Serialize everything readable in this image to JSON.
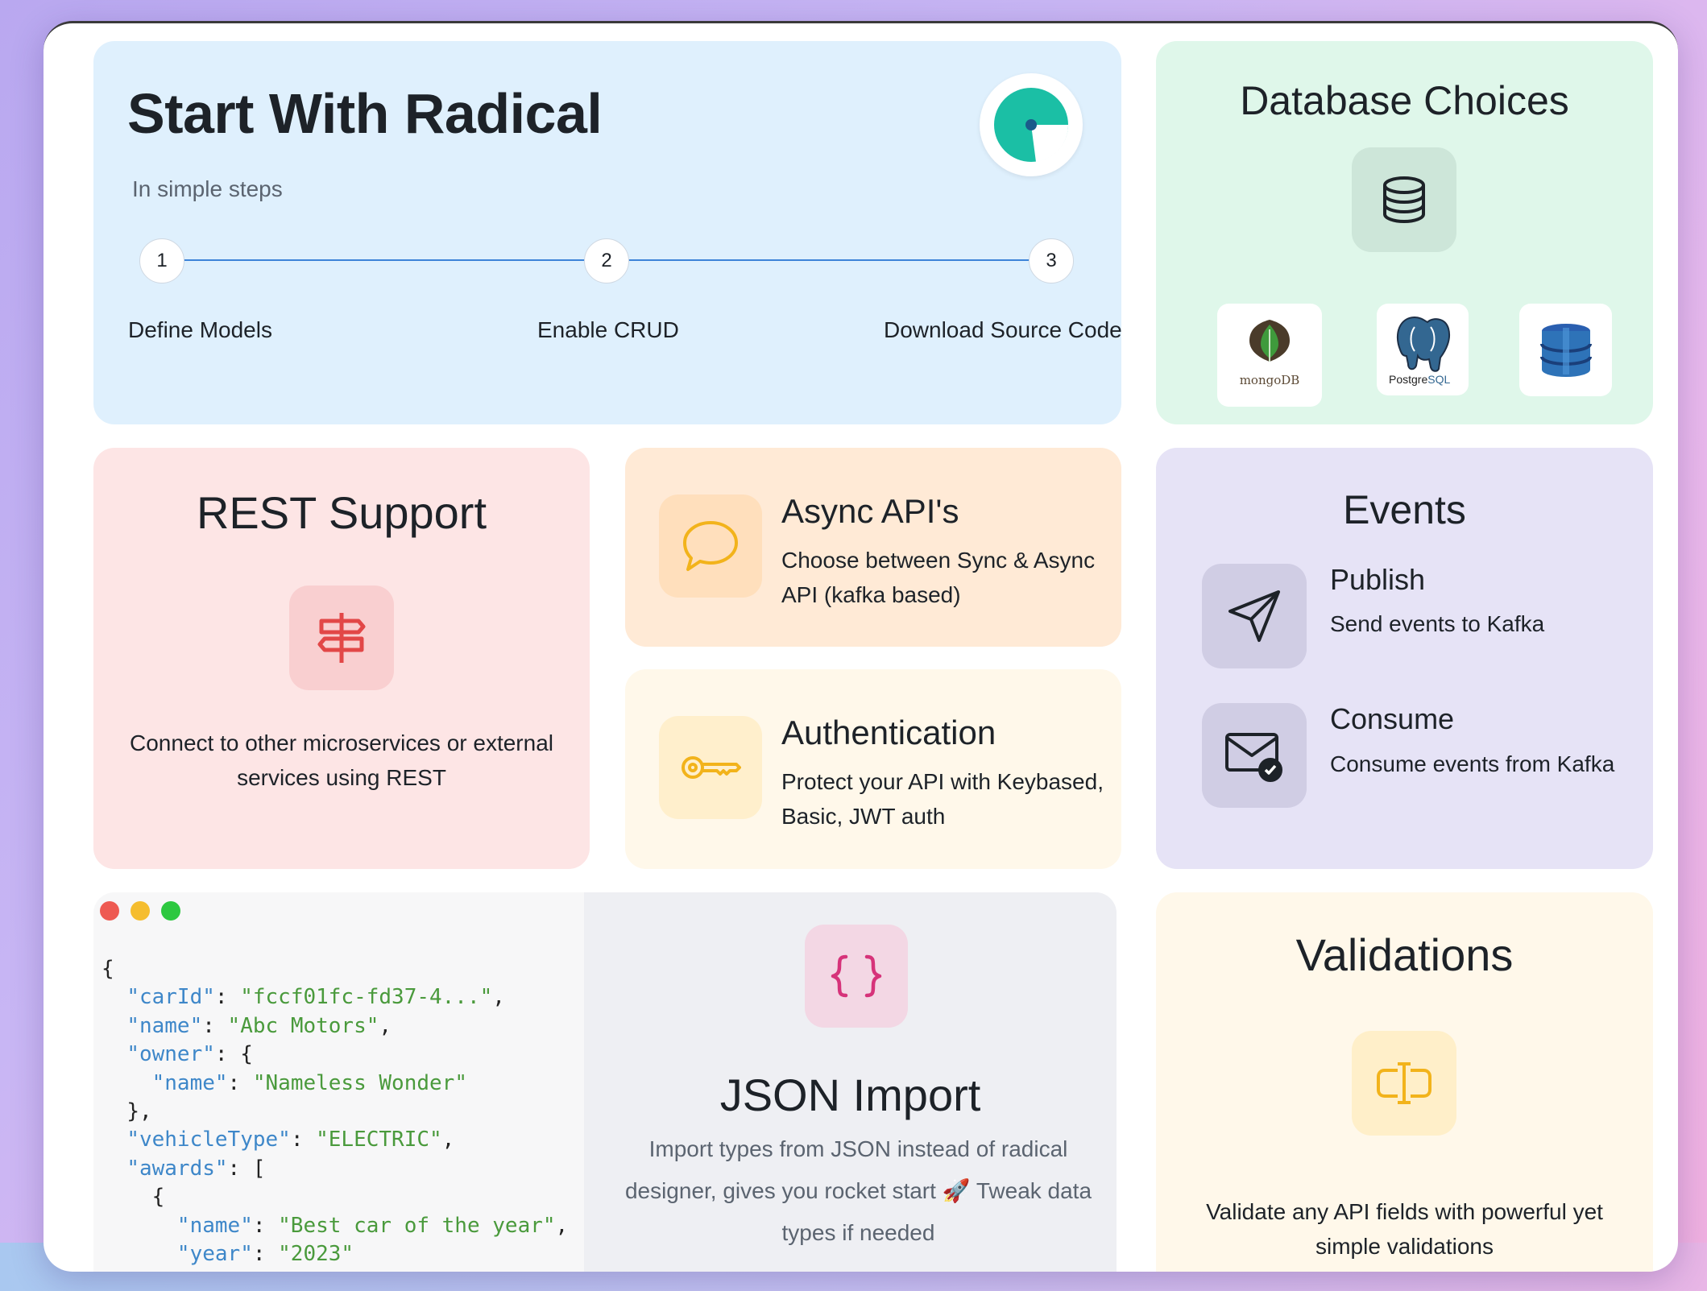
{
  "start": {
    "title": "Start With Radical",
    "subtitle": "In simple steps",
    "steps": [
      {
        "number": "1",
        "label": "Define Models"
      },
      {
        "number": "2",
        "label": "Enable CRUD"
      },
      {
        "number": "3",
        "label": "Download Source Code"
      }
    ],
    "logo_icon": "radical-logo-icon"
  },
  "database": {
    "title": "Database Choices",
    "icon": "database-icon",
    "logos": [
      {
        "name": "mongodb-logo",
        "text": "mongoDB"
      },
      {
        "name": "postgresql-logo",
        "text_a": "Postgre",
        "text_b": "SQL"
      },
      {
        "name": "dynamodb-logo"
      }
    ]
  },
  "rest": {
    "title": "REST Support",
    "icon": "signpost-icon",
    "description": "Connect to other microservices or external services using REST"
  },
  "async": {
    "title": "Async API's",
    "icon": "chat-bubble-icon",
    "description": "Choose between Sync & Async API (kafka based)"
  },
  "auth": {
    "title": "Authentication",
    "icon": "key-icon",
    "description": "Protect your API with Keybased, Basic, JWT auth"
  },
  "events": {
    "title": "Events",
    "items": [
      {
        "title": "Publish",
        "description": "Send events to Kafka",
        "icon": "send-icon"
      },
      {
        "title": "Consume",
        "description": "Consume events from Kafka",
        "icon": "mail-check-icon"
      }
    ]
  },
  "code": {
    "lines": [
      {
        "indent": "",
        "key": "",
        "value": "",
        "punct": "{"
      },
      {
        "indent": "  ",
        "key": "\"carId\"",
        "sep": ": ",
        "value": "\"fccf01fc-fd37-4...\"",
        "punct": ","
      },
      {
        "indent": "  ",
        "key": "\"name\"",
        "sep": ": ",
        "value": "\"Abc Motors\"",
        "punct": ","
      },
      {
        "indent": "  ",
        "key": "\"owner\"",
        "sep": ": ",
        "value": "",
        "punct": "{"
      },
      {
        "indent": "    ",
        "key": "\"name\"",
        "sep": ": ",
        "value": "\"Nameless Wonder\"",
        "punct": ""
      },
      {
        "indent": "  ",
        "key": "",
        "value": "",
        "punct": "},"
      },
      {
        "indent": "  ",
        "key": "\"vehicleType\"",
        "sep": ": ",
        "value": "\"ELECTRIC\"",
        "punct": ","
      },
      {
        "indent": "  ",
        "key": "\"awards\"",
        "sep": ": ",
        "value": "",
        "punct": "["
      },
      {
        "indent": "    ",
        "key": "",
        "value": "",
        "punct": "{"
      },
      {
        "indent": "      ",
        "key": "\"name\"",
        "sep": ": ",
        "value": "\"Best car of the year\"",
        "punct": ","
      },
      {
        "indent": "      ",
        "key": "\"year\"",
        "sep": ": ",
        "value": "\"2023\"",
        "punct": ""
      }
    ]
  },
  "json_import": {
    "title": "JSON Import",
    "icon": "braces-icon",
    "description_a": "Import types from JSON instead of radical designer, gives you rocket start ",
    "emoji": "🚀",
    "description_b": " Tweak data types if needed"
  },
  "validations": {
    "title": "Validations",
    "icon": "text-cursor-icon",
    "description": "Validate any API fields with powerful yet simple validations"
  },
  "colors": {
    "window_red": "#ee5a52",
    "window_yellow": "#f5bd2f",
    "window_green": "#2dc840",
    "accent_blue": "#3d83d8"
  }
}
